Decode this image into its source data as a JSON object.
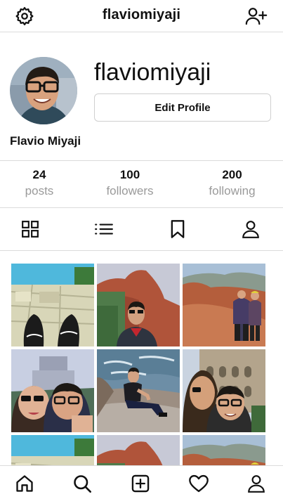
{
  "header": {
    "title": "flaviomiyaji",
    "settings_icon": "gear-icon",
    "add_user_icon": "user-plus-icon"
  },
  "profile": {
    "username": "flaviomiyaji",
    "edit_label": "Edit Profile",
    "full_name": "Flavio Miyaji"
  },
  "stats": [
    {
      "count": "24",
      "label": "posts"
    },
    {
      "count": "100",
      "label": "followers"
    },
    {
      "count": "200",
      "label": "following"
    }
  ],
  "tabs": [
    "grid-icon",
    "list-icon",
    "bookmark-icon",
    "tagged-person-icon"
  ],
  "photos": [
    "feet-on-stone-ruins",
    "portrait-red-rocks",
    "couple-on-red-rocks",
    "couple-selfie-castle",
    "man-sitting-by-river",
    "couple-selfie-colosseum",
    "feet-on-stone-ruins",
    "portrait-red-rocks",
    "couple-on-red-rocks"
  ],
  "bottom_nav": [
    "home-icon",
    "search-icon",
    "new-post-icon",
    "heart-icon",
    "profile-icon"
  ]
}
